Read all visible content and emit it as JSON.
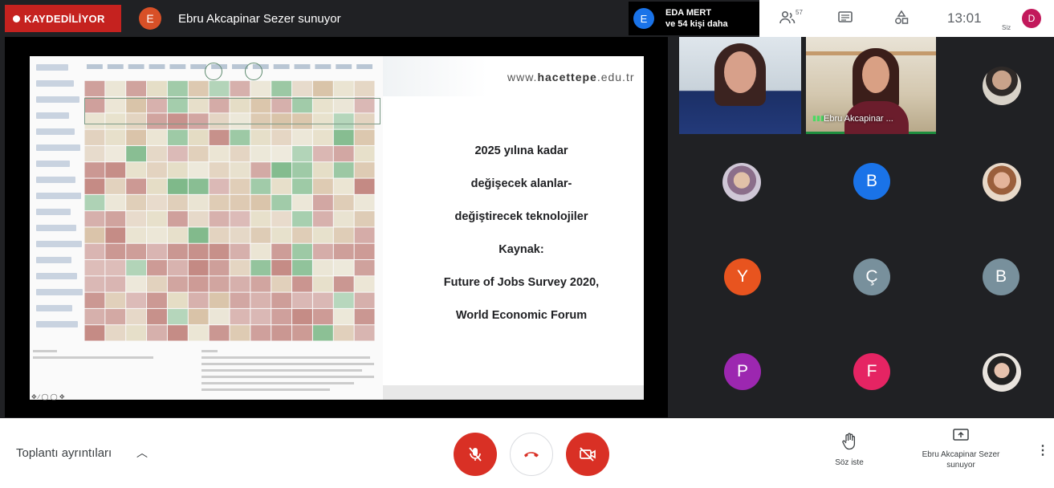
{
  "topbar": {
    "recording_label": "KAYDEDİLİYOR",
    "presenter_initial": "E",
    "presenter_label": "Ebru Akcapinar Sezer sunuyor",
    "viewer_initial": "E",
    "viewer_name": "EDA MERT",
    "viewer_more": "ve 54 kişi daha",
    "participant_count": "57",
    "time": "13:01",
    "self_label": "Siz",
    "self_initial": "D"
  },
  "slide": {
    "url_prefix": "www.",
    "url_bold": "hacettepe",
    "url_suffix": ".edu.tr",
    "lines": [
      "2025 yılına kadar",
      "değişecek alanlar-",
      "değiştirecek teknolojiler",
      "Kaynak:",
      "Future of Jobs Survey 2020,",
      "World Economic Forum"
    ],
    "heatmap_colors": {
      "green": "#7fb98a",
      "light": "#e4dcc4",
      "tan": "#d9c3a8",
      "red": "#c48a84"
    }
  },
  "participants": {
    "video_name": "Ebru Akcapinar ...",
    "avatars": [
      {
        "initial": "B",
        "color": "#1a73e8"
      },
      {
        "initial": "Y",
        "color": "#e8541f"
      },
      {
        "initial": "Ç",
        "color": "#78909c"
      },
      {
        "initial": "B",
        "color": "#78909c"
      },
      {
        "initial": "P",
        "color": "#9c27b0"
      },
      {
        "initial": "F",
        "color": "#e52463"
      }
    ]
  },
  "bottombar": {
    "meeting_details": "Toplantı ayrıntıları",
    "raise_hand": "Söz iste",
    "presenting_line1": "Ebru Akcapinar Sezer",
    "presenting_line2": "sunuyor"
  },
  "colors": {
    "accent_red": "#d93025",
    "dark_bg": "#202124",
    "recording_red": "#c5221f"
  }
}
